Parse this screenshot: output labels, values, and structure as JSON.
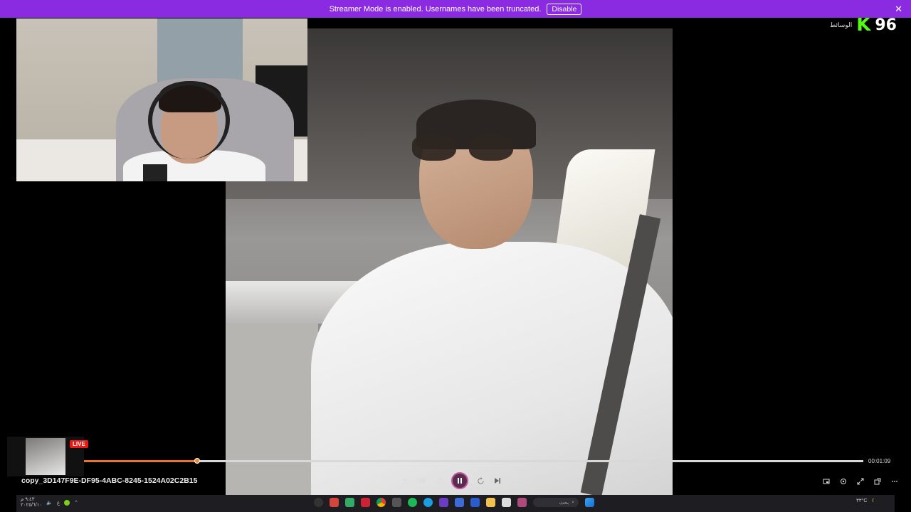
{
  "banner": {
    "message": "Streamer Mode is enabled. Usernames have been truncated.",
    "disable_label": "Disable",
    "close_glyph": "✕",
    "bg_color": "#8a2be2"
  },
  "brand": {
    "arabic_text": "الوسائط",
    "logo_letter": "K",
    "logo_number": "96",
    "accent_color": "#53fc18"
  },
  "mini_player": {
    "live_badge": "LIVE"
  },
  "player": {
    "filename": "copy_3D147F9E-DF95-4ABC-8245-1524A02C2B15",
    "elapsed": "00:01:09",
    "progress_fraction": 0.145,
    "progress_color": "#e8742c",
    "controls": {
      "shuffle_icon": "shuffle-icon",
      "prev_icon": "previous-icon",
      "rewind_icon": "rewind-icon",
      "play_pause_icon": "pause-icon",
      "forward_icon": "fast-forward-icon",
      "next_icon": "next-icon",
      "repeat_icon": "repeat-icon"
    },
    "right_controls": [
      "miniplayer-icon",
      "cast-icon",
      "fullscreen-icon",
      "popout-icon",
      "more-icon"
    ]
  },
  "taskbar": {
    "search_label": "بحث",
    "weather": "٣٣°C",
    "clock_time": "٩:٤٣ م",
    "clock_date": "٢٠٢٥/٦/١٠",
    "lang": "ع"
  }
}
